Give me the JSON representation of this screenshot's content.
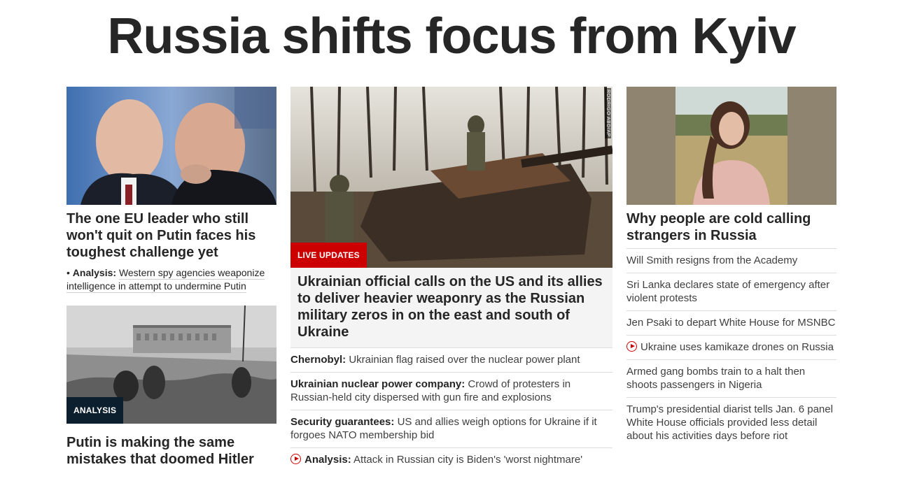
{
  "page": {
    "headline": "Russia shifts focus from Kyiv"
  },
  "left": {
    "story1": {
      "image_alt": "Putin and Orban talking",
      "title": "The one EU leader who still won't quit on Putin faces his toughest challenge yet",
      "sub_prefix": "Analysis:",
      "sub_text": "Western spy agencies weaponize intelligence in attempt to undermine Putin"
    },
    "story2": {
      "label": "ANALYSIS",
      "title": "Putin is making the same mistakes that doomed Hitler"
    }
  },
  "middle": {
    "image_credit": "RODRIGO ABD/AP",
    "label": "LIVE UPDATES",
    "title": "Ukrainian official calls on the US and its allies to deliver heavier weaponry as the Russian military zeros in on the east and south of Ukraine",
    "items": [
      {
        "key": "Chernobyl:",
        "text": "Ukrainian flag raised over the nuclear power plant",
        "video": false
      },
      {
        "key": "Ukrainian nuclear power company:",
        "text": "Crowd of protesters in Russian-held city dispersed with gun fire and explosions",
        "video": false
      },
      {
        "key": "Security guarantees:",
        "text": "US and allies weigh options for Ukraine if it forgoes NATO membership bid",
        "video": false
      },
      {
        "key": "Analysis:",
        "text": "Attack in Russian city is Biden's 'worst nightmare'",
        "video": true
      }
    ]
  },
  "right": {
    "title": "Why people are cold calling strangers in Russia",
    "items": [
      {
        "text": "Will Smith resigns from the Academy",
        "video": false
      },
      {
        "text": "Sri Lanka declares state of emergency after violent protests",
        "video": false
      },
      {
        "text": "Jen Psaki to depart White House for MSNBC",
        "video": false
      },
      {
        "text": "Ukraine uses kamikaze drones on Russia",
        "video": true
      },
      {
        "text": "Armed gang bombs train to a halt then shoots passengers in Nigeria",
        "video": false
      },
      {
        "text": "Trump's presidential diarist tells Jan. 6 panel White House officials provided less detail about his activities days before riot",
        "video": false
      }
    ]
  },
  "colors": {
    "red_label": "#cc0000",
    "dark_label": "#0c1f2e",
    "text_dark": "#262626",
    "text_body": "#404040",
    "divider": "#dcdcdc",
    "feature_bg": "#f4f4f4"
  },
  "icons": {
    "video_item": "play-circle-icon"
  }
}
